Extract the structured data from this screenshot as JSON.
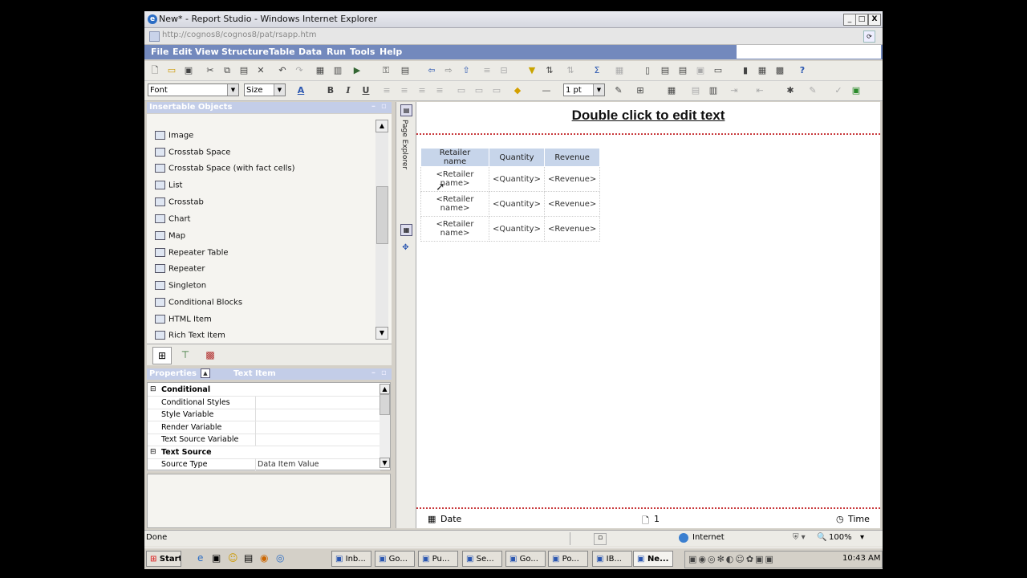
{
  "window": {
    "title": "New* - Report Studio - Windows Internet Explorer",
    "url": "http://cognos8/cognos8/pat/rsapp.htm",
    "min": "_",
    "max": "□",
    "close": "X"
  },
  "menu": [
    "File",
    "Edit",
    "View",
    "Structure",
    "Table",
    "Data",
    "Run",
    "Tools",
    "Help"
  ],
  "toolbar2": {
    "font": "Font",
    "size": "Size",
    "bold": "B",
    "italic": "I",
    "underline": "U",
    "border_width": "1 pt"
  },
  "insertable": {
    "header": "Insertable Objects",
    "items": [
      {
        "label": "Image",
        "icon": "image-icon"
      },
      {
        "label": "Crosstab Space",
        "icon": "crosstab-space-icon"
      },
      {
        "label": "Crosstab Space (with fact cells)",
        "icon": "crosstab-space-fact-icon"
      },
      {
        "label": "List",
        "icon": "list-icon"
      },
      {
        "label": "Crosstab",
        "icon": "crosstab-icon"
      },
      {
        "label": "Chart",
        "icon": "chart-icon"
      },
      {
        "label": "Map",
        "icon": "map-icon"
      },
      {
        "label": "Repeater Table",
        "icon": "repeater-table-icon"
      },
      {
        "label": "Repeater",
        "icon": "repeater-icon"
      },
      {
        "label": "Singleton",
        "icon": "singleton-icon"
      },
      {
        "label": "Conditional Blocks",
        "icon": "conditional-blocks-icon"
      },
      {
        "label": "HTML Item",
        "icon": "html-item-icon"
      },
      {
        "label": "Rich Text Item",
        "icon": "rich-text-item-icon"
      }
    ]
  },
  "properties": {
    "header": "Properties",
    "subheader": "Text Item",
    "rows": [
      {
        "label": "Conditional",
        "value": "",
        "group": true
      },
      {
        "label": "Conditional Styles",
        "value": "",
        "group": false
      },
      {
        "label": "Style Variable",
        "value": "",
        "group": false
      },
      {
        "label": "Render Variable",
        "value": "",
        "group": false
      },
      {
        "label": "Text Source Variable",
        "value": "",
        "group": false
      },
      {
        "label": "Text Source",
        "value": "",
        "group": true
      },
      {
        "label": "Source Type",
        "value": "Data Item Value",
        "group": false
      }
    ]
  },
  "page_explorer": "Page Explorer",
  "canvas": {
    "title": "Double click to edit text",
    "columns": [
      "Retailer name",
      "Quantity",
      "Revenue"
    ],
    "rows": [
      [
        "<Retailer name>",
        "<Quantity>",
        "<Revenue>"
      ],
      [
        "<Retailer name>",
        "<Quantity>",
        "<Revenue>"
      ],
      [
        "<Retailer name>",
        "<Quantity>",
        "<Revenue>"
      ]
    ],
    "footer_date": "Date",
    "footer_page": "1",
    "footer_time": "Time"
  },
  "status": {
    "text": "Done",
    "zone": "Internet",
    "zoom": "100%"
  },
  "taskbar": {
    "start": "Start",
    "buttons": [
      "Inb...",
      "Go...",
      "Pu...",
      "Se...",
      "Go...",
      "Po...",
      "IB...",
      "Ne..."
    ],
    "clock": "10:43 AM"
  }
}
